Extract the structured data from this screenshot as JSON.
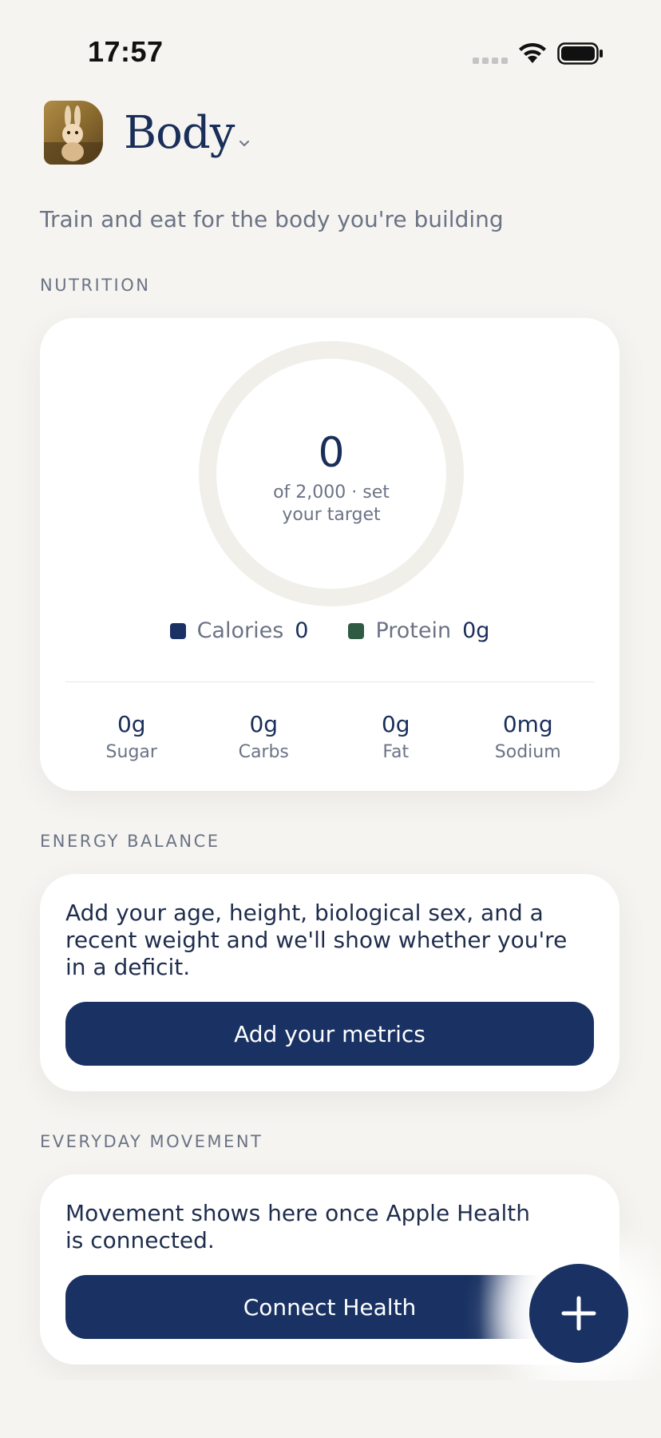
{
  "status_bar": {
    "time": "17:57"
  },
  "header": {
    "title": "Body"
  },
  "subtitle": "Train and eat for the body you're building",
  "nutrition": {
    "section_label": "NUTRITION",
    "ring": {
      "value": "0",
      "sub": "of 2,000 · set your target",
      "progress": 0
    },
    "legend": [
      {
        "label": "Calories",
        "value": "0",
        "color": "#1a3263"
      },
      {
        "label": "Protein",
        "value": "0g",
        "color": "#2f5a44"
      }
    ],
    "macros": [
      {
        "value": "0g",
        "label": "Sugar"
      },
      {
        "value": "0g",
        "label": "Carbs"
      },
      {
        "value": "0g",
        "label": "Fat"
      },
      {
        "value": "0mg",
        "label": "Sodium"
      }
    ]
  },
  "energy_balance": {
    "section_label": "ENERGY BALANCE",
    "text": "Add your age, height, biological sex, and a recent weight and we'll show whether you're in a deficit.",
    "button_label": "Add your metrics"
  },
  "everyday_movement": {
    "section_label": "EVERYDAY MOVEMENT",
    "text": "Movement shows here once Apple Health is connected.",
    "button_label": "Connect Health"
  },
  "fab": {
    "icon": "plus-icon"
  },
  "colors": {
    "accent": "#1a3263",
    "protein": "#2f5a44",
    "ring_track": "#f1efea",
    "background": "#f5f4f0"
  }
}
